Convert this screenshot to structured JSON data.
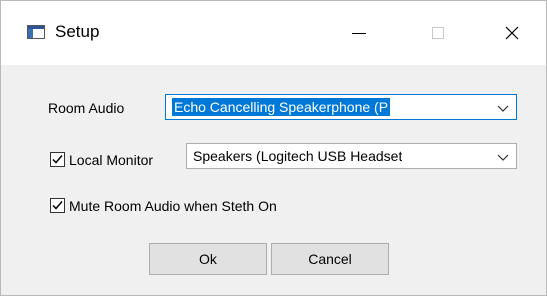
{
  "window": {
    "title": "Setup",
    "icon": "window-app-icon"
  },
  "controls": {
    "minimize_icon": "minimize-icon",
    "maximize_icon": "maximize-icon",
    "close_icon": "close-icon"
  },
  "room_audio": {
    "label": "Room Audio",
    "selected": "Echo Cancelling Speakerphone (P"
  },
  "local_monitor": {
    "label": "Local Monitor",
    "checked": true,
    "selected": "Speakers (Logitech USB Headset"
  },
  "mute_room_audio": {
    "label": "Mute Room Audio when Steth On",
    "checked": true
  },
  "buttons": {
    "ok": "Ok",
    "cancel": "Cancel"
  },
  "colors": {
    "accent": "#0078d7",
    "dialog_bg": "#f0f0f0",
    "button_bg": "#e1e1e1"
  }
}
